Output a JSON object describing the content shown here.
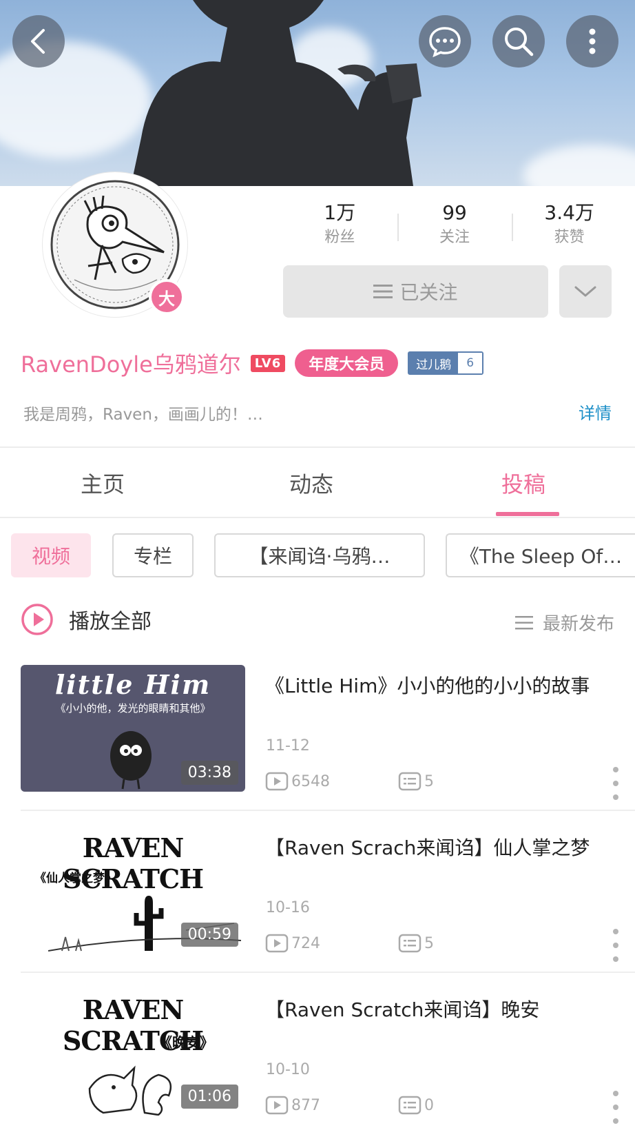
{
  "header": {
    "back_icon": "chevron-left-icon",
    "chat_icon": "chat-bubble-icon",
    "search_icon": "search-icon",
    "more_icon": "more-vertical-icon"
  },
  "profile": {
    "avatar_badge": "大",
    "stats": [
      {
        "value": "1万",
        "label": "粉丝"
      },
      {
        "value": "99",
        "label": "关注"
      },
      {
        "value": "3.4万",
        "label": "获赞"
      }
    ],
    "follow_label": "已关注",
    "username": "RavenDoyle乌鸦道尔",
    "level": "LV6",
    "vip_label": "年度大会员",
    "medal_name": "过儿鹅",
    "medal_level": "6",
    "bio": "我是周鸦，Raven，画画儿的！…",
    "detail_label": "详情",
    "colors": {
      "accent": "#ef6f9a",
      "link": "#1e90c8",
      "medal": "#5b7fae"
    }
  },
  "tabs": [
    {
      "label": "主页",
      "active": false
    },
    {
      "label": "动态",
      "active": false
    },
    {
      "label": "投稿",
      "active": true
    }
  ],
  "filters": [
    {
      "label": "视频",
      "active": true
    },
    {
      "label": "专栏",
      "active": false
    },
    {
      "label": "【来闻诌·乌鸦…",
      "active": false
    },
    {
      "label": "《The Sleep Of…",
      "active": false
    }
  ],
  "play_all_label": "播放全部",
  "sort_label": "最新发布",
  "videos": [
    {
      "title": "《Little Him》小小的他的小小的故事",
      "date": "11-12",
      "views": "6548",
      "comments": "5",
      "duration": "03:38",
      "thumb_title": "little Him",
      "thumb_subtitle": "《小小的他，发光的眼睛和其他》"
    },
    {
      "title": "【Raven Scrach来闻诌】仙人掌之梦",
      "date": "10-16",
      "views": "724",
      "comments": "5",
      "duration": "00:59",
      "thumb_title": "RAVEN SCRATCH",
      "thumb_subtitle": "《仙人掌之梦》"
    },
    {
      "title": "【Raven Scratch来闻诌】晚安",
      "date": "10-10",
      "views": "877",
      "comments": "0",
      "duration": "01:06",
      "thumb_title": "RAVEN SCRATCH",
      "thumb_subtitle": "《晚安》"
    }
  ]
}
